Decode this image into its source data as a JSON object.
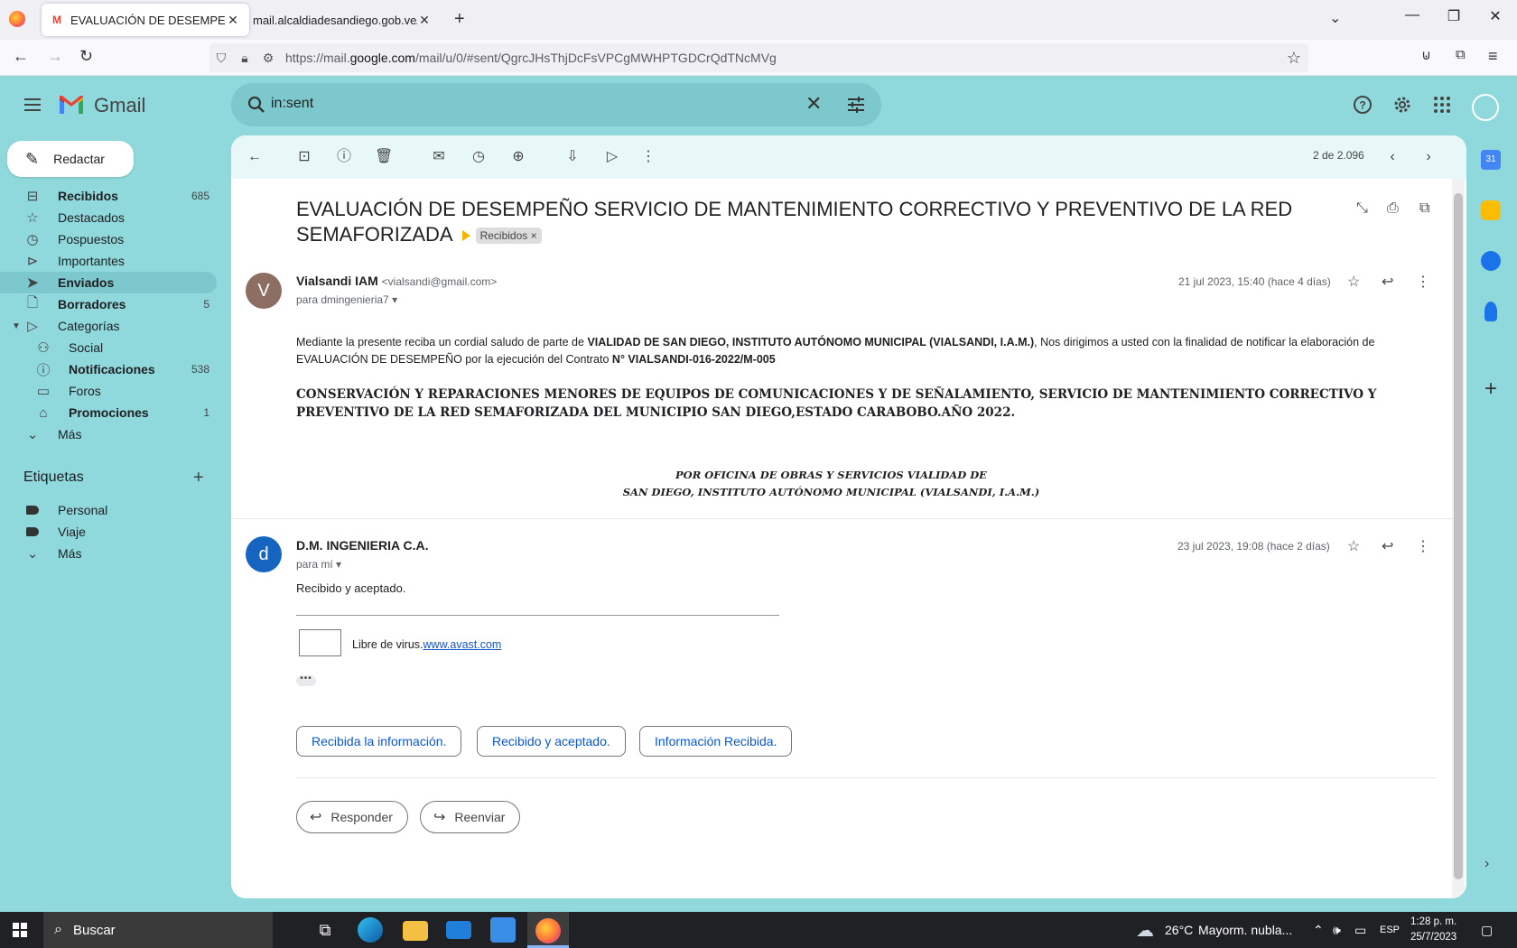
{
  "browser": {
    "tabs": [
      {
        "title": "EVALUACIÓN DE DESEMPEÑO S",
        "favicon": "gmail-icon",
        "active": true
      },
      {
        "title": "mail.alcaldiadesandiego.gob.ve/car",
        "active": false
      }
    ],
    "url_prefix": "https://mail.",
    "url_domain": "google.com",
    "url_path": "/mail/u/0/#sent/QgrcJHsThjDcFsVPCgMWHPTGDCrQdTNcMVg"
  },
  "gmail": {
    "app_name": "Gmail",
    "search_value": "in:sent",
    "compose_label": "Redactar",
    "nav": [
      {
        "label": "Recibidos",
        "count": "685",
        "icon": "inbox-icon",
        "bold": true
      },
      {
        "label": "Destacados",
        "count": "",
        "icon": "star-icon"
      },
      {
        "label": "Pospuestos",
        "count": "",
        "icon": "clock-icon"
      },
      {
        "label": "Importantes",
        "count": "",
        "icon": "important-icon"
      },
      {
        "label": "Enviados",
        "count": "",
        "icon": "send-icon",
        "active": true
      },
      {
        "label": "Borradores",
        "count": "5",
        "icon": "draft-icon",
        "bold": true
      },
      {
        "label": "Categorías",
        "count": "",
        "icon": "label-icon"
      },
      {
        "label": "Social",
        "count": "",
        "icon": "people-icon"
      },
      {
        "label": "Notificaciones",
        "count": "538",
        "icon": "info-icon",
        "bold": true
      },
      {
        "label": "Foros",
        "count": "",
        "icon": "forum-icon"
      },
      {
        "label": "Promociones",
        "count": "1",
        "icon": "tag-icon",
        "bold": true
      },
      {
        "label": "Más",
        "count": "",
        "icon": "chevron-down-icon"
      }
    ],
    "labels_title": "Etiquetas",
    "labels": [
      {
        "label": "Personal"
      },
      {
        "label": "Viaje"
      },
      {
        "label": "Más"
      }
    ],
    "pager": "2 de 2.096",
    "subject": "EVALUACIÓN DE DESEMPEÑO SERVICIO DE MANTENIMIENTO CORRECTIVO Y PREVENTIVO DE LA RED SEMAFORIZADA",
    "subject_chip": "Recibidos",
    "messages": [
      {
        "avatar": "V",
        "sender_name": "Vialsandi IAM",
        "sender_email": "<vialsandi@gmail.com>",
        "to": "para dmingenieria7",
        "date": "21 jul 2023, 15:40 (hace 4 días)",
        "body_p1_a": "Mediante la presente reciba un cordial saludo de parte de ",
        "body_p1_b": "VIALIDAD DE SAN DIEGO, INSTITUTO AUTÓNOMO MUNICIPAL (VIALSANDI, I.A.M.)",
        "body_p1_c": ", Nos dirigimos a usted con la finalidad de notificar la elaboración de EVALUACIÓN DE DESEMPEÑO por la ejecución del Contrato  ",
        "body_p1_d": "N° VIALSANDI-016-2022/M-005",
        "body_p2": "CONSERVACIÓN Y REPARACIONES MENORES DE EQUIPOS DE COMUNICACIONES Y DE SEÑALAMIENTO, SERVICIO DE MANTENIMIENTO CORRECTIVO Y PREVENTIVO DE LA RED SEMAFORIZADA DEL MUNICIPIO SAN DIEGO,ESTADO CARABOBO.AÑO 2022.",
        "sig_line1": "POR  OFICINA DE OBRAS Y SERVICIOS VIALIDAD DE",
        "sig_line2": "SAN DIEGO, INSTITUTO AUTÓNOMO MUNICIPAL (VIALSANDI, I.A.M.)"
      },
      {
        "avatar": "d",
        "sender_name": "D.M. INGENIERIA C.A.",
        "to": "para mí",
        "date": "23 jul 2023, 19:08 (hace 2 días)",
        "body": "Recibido y aceptado.",
        "virus_text": "Libre de virus.",
        "virus_link": "www.avast.com"
      }
    ],
    "smart_replies": [
      "Recibida la información.",
      "Recibido y aceptado.",
      "Información Recibida."
    ],
    "reply_label": "Responder",
    "forward_label": "Reenviar"
  },
  "taskbar": {
    "search_placeholder": "Buscar",
    "weather_temp": "26°C",
    "weather_desc": "Mayorm. nubla...",
    "lang": "ESP",
    "time": "1:28 p. m.",
    "date": "25/7/2023"
  },
  "colors": {
    "theme_bg": "#8fd8dc",
    "accent": "#0b57d0",
    "important_marker": "#f5b400"
  }
}
